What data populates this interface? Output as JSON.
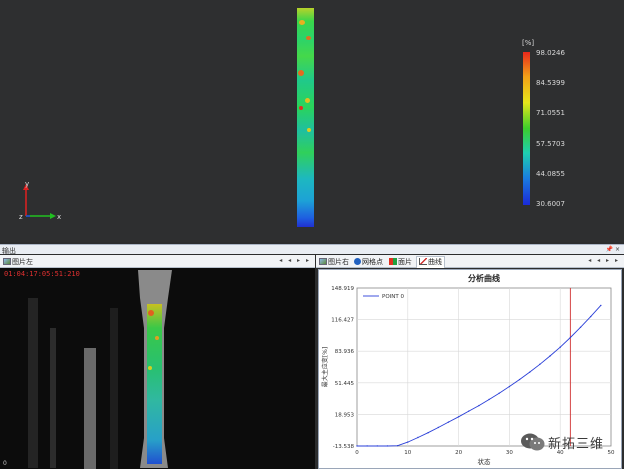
{
  "viewport": {
    "colorbar": {
      "unit": "[%]",
      "labels": [
        "98.0246",
        "84.5399",
        "71.0551",
        "57.5703",
        "44.0855",
        "30.6007"
      ]
    },
    "axes": {
      "y": "y",
      "z": "z",
      "x": "x"
    }
  },
  "output": {
    "title": "输出",
    "pin": "📌 ×"
  },
  "left_panel": {
    "tab_label": "图片左",
    "nav": "◂ ◂ ▸ ▸",
    "timestamp": "01:04:17:05:51:210",
    "frame_index": "0"
  },
  "right_panel": {
    "tabs": [
      "图片右",
      "网格点",
      "面片",
      "曲线"
    ],
    "nav": "◂ ◂ ▸ ▸"
  },
  "chart_data": {
    "type": "line",
    "title": "分析曲线",
    "xlabel": "状态",
    "ylabel": "最大主应变[%]",
    "xlim": [
      0,
      50
    ],
    "ylim": [
      -13.538,
      148.919
    ],
    "xticks": [
      "0",
      "10",
      "20",
      "30",
      "40",
      "50"
    ],
    "yticks": [
      "148.919",
      "116.427",
      "83.936",
      "51.445",
      "18.953",
      "-13.538"
    ],
    "series": [
      {
        "name": "POINT 0",
        "color": "#2a3fd8",
        "x": [
          0,
          2,
          4,
          6,
          8,
          10,
          12,
          14,
          16,
          18,
          20,
          22,
          24,
          26,
          28,
          30,
          32,
          34,
          36,
          38,
          40,
          42,
          44,
          46,
          48
        ],
        "y": [
          -13.5,
          -13.5,
          -13.5,
          -13.5,
          -13.2,
          -9.5,
          -4.8,
          0.1,
          5.5,
          11.0,
          16.5,
          22.3,
          28.0,
          34.3,
          40.8,
          47.6,
          54.8,
          62.4,
          70.5,
          79.0,
          88.0,
          98.0,
          108.5,
          119.5,
          131.0
        ]
      }
    ],
    "vline": {
      "x": 42,
      "color": "#d03030"
    },
    "legend": "top-left",
    "grid": true
  },
  "watermark": {
    "text": "新拓三维"
  }
}
